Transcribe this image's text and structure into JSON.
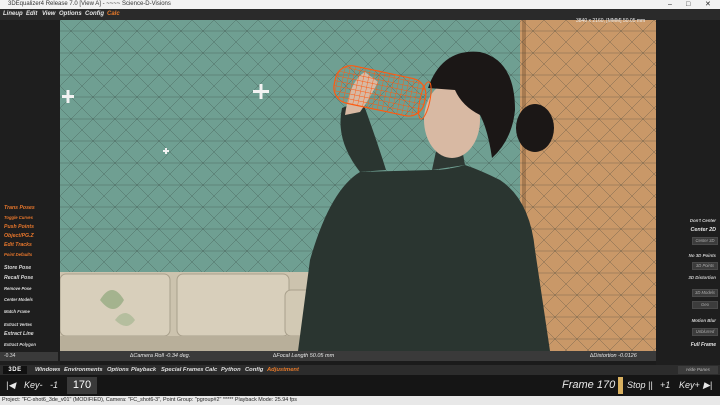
{
  "window": {
    "title": "3DEqualizer4 Release 7.0 [View A] - ~~~~ Science-D-Visions",
    "controls": [
      "–",
      "□",
      "✕"
    ]
  },
  "menubar": {
    "items": [
      "Lineup",
      "Edit",
      "View",
      "Options",
      "Config",
      "Calc"
    ],
    "highlighted": "Calc"
  },
  "left_panel": {
    "items": [
      {
        "label": "Trans Poses",
        "style": "orange"
      },
      {
        "label": "Toggle Curves",
        "style": "orange-small"
      },
      {
        "label": "Push Points",
        "style": "orange"
      },
      {
        "label": "Object/PG.Z",
        "style": "orange"
      },
      {
        "label": "Edit Tracks",
        "style": "orange"
      },
      {
        "label": "Point Defaults",
        "style": "orange-small"
      },
      {
        "label": "Store Pose",
        "style": "white"
      },
      {
        "label": "Recall Pose",
        "style": "white"
      },
      {
        "label": "Remove Pose",
        "style": "white-small"
      },
      {
        "label": "Center Models",
        "style": "white-small"
      },
      {
        "label": "Match Frame",
        "style": "white-small"
      },
      {
        "label": "Extract Vertex",
        "style": "white-small"
      },
      {
        "label": "Extract Line",
        "style": "white"
      },
      {
        "label": "Extract Polygon",
        "style": "white-small"
      }
    ],
    "value_field": "-0.34"
  },
  "right_panel": {
    "items": [
      {
        "label": "Don't Center",
        "button": null
      },
      {
        "label": "Center 2D",
        "button": "Center 3D"
      },
      {
        "label": "No 3D Points",
        "button": "3D Points"
      },
      {
        "label": "3D Distortion",
        "button": "3D Models"
      },
      {
        "label": "Geo",
        "button": null
      },
      {
        "label": "Motion Blur",
        "button": "Unblurred"
      },
      {
        "label": "Full Frame",
        "button": null
      }
    ],
    "hide_panes": "Hide Panes"
  },
  "viewport": {
    "resolution_label": "3840 x 2160, [MMM] 50.05 mm"
  },
  "infobar": {
    "roll": "∆Camera Roll -0.34 deg.",
    "focal": "∆Focal Length 50.05 mm",
    "distortion": "∆Distortion -0.0126"
  },
  "bottom_menu": {
    "logo": "3DE",
    "items": [
      "Windows",
      "Environments",
      "Options",
      "Playback",
      "Special Frames",
      "Calc",
      "Python",
      "Config",
      "Adjustment"
    ],
    "highlighted": "Adjustment"
  },
  "timeline": {
    "goto_start": "|◀",
    "key_prev": "Key-",
    "minus_one": "-1",
    "frame_value": "170",
    "frame_label": "Frame 170",
    "stop": "Stop ||",
    "plus_one": "+1",
    "key_next": "Key+",
    "goto_end": "▶|"
  },
  "statusbar": {
    "text": "Project: \"FC-shot6_3de_v01\" (MODIFIED), Camera: \"FC_shot6-3\", Point Group: \"pgroup#2\" ***** Playback Mode: 25.94 fps"
  },
  "colors": {
    "accent_orange": "#e87a2a",
    "mesh_orange": "#ff5a10",
    "wall_green": "#6f9f92",
    "wood_panel": "#c99868"
  }
}
